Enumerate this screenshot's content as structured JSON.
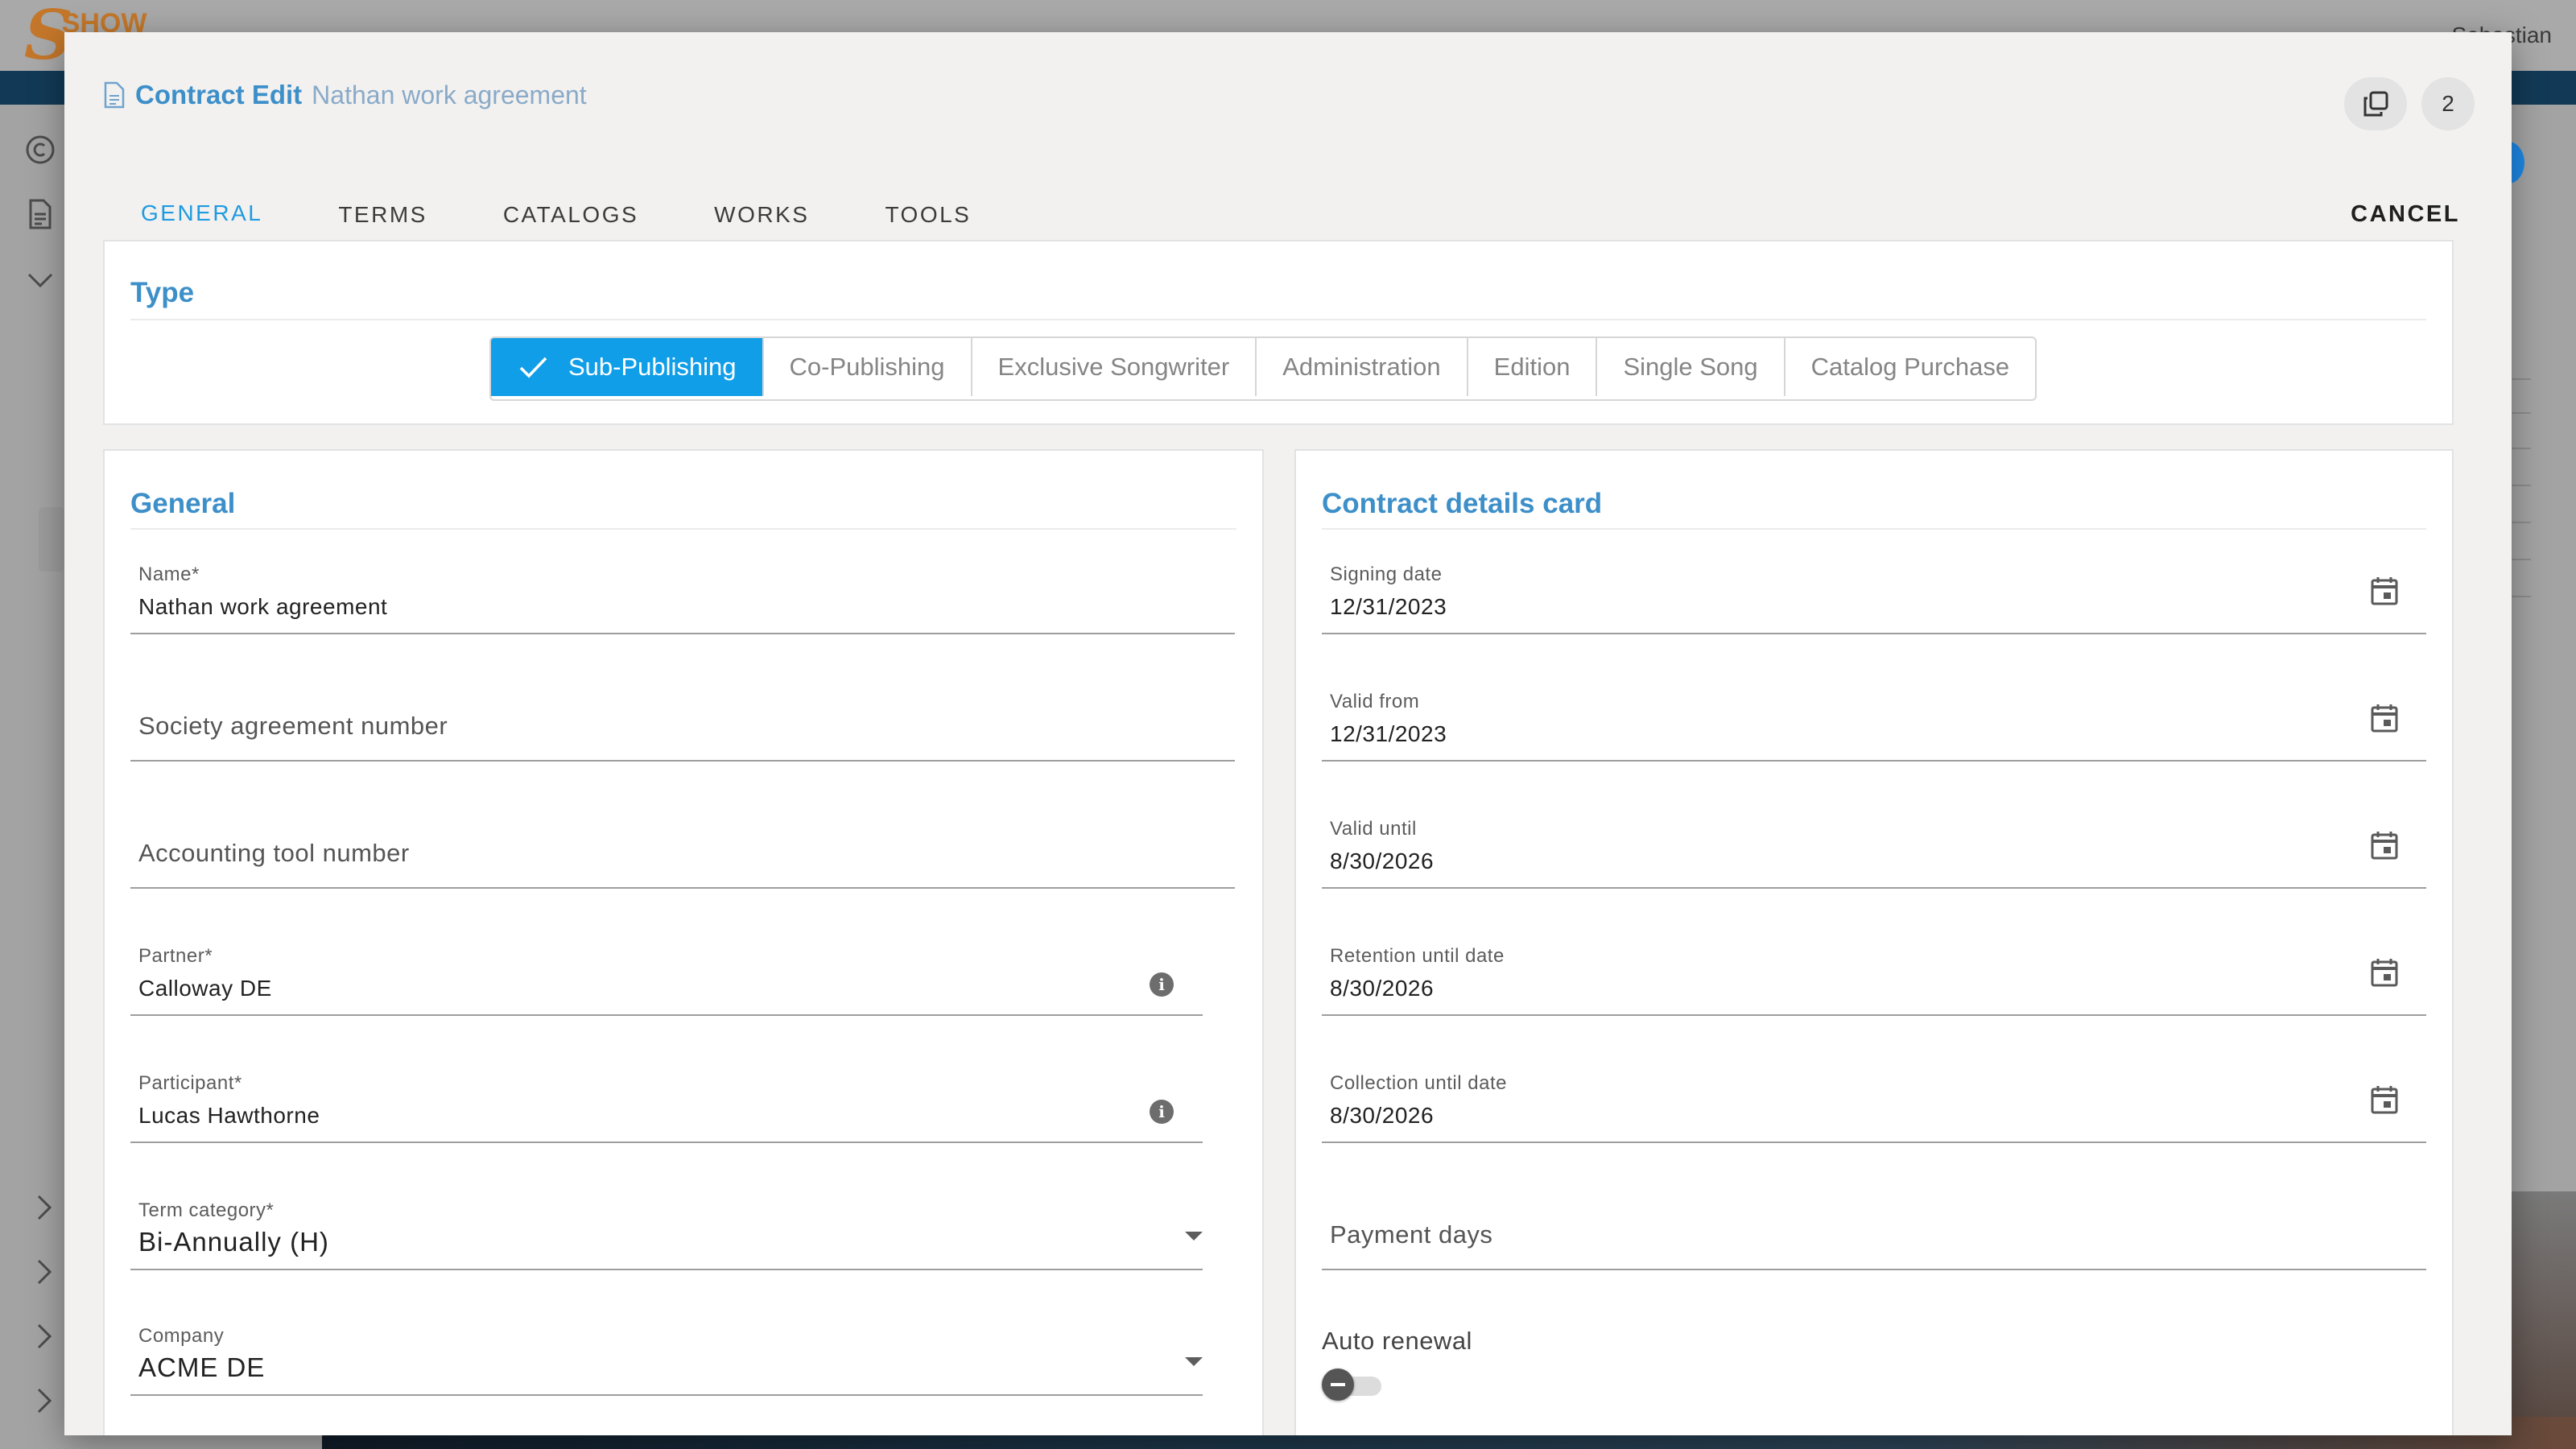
{
  "app": {
    "logo_text": "SHOW",
    "user_name": "Sebastian"
  },
  "dialog": {
    "title": "Contract Edit",
    "subtitle": "Nathan work agreement",
    "badge_count": "2",
    "copy_icon": "copy-icon",
    "cancel_label": "CANCEL",
    "tabs": [
      {
        "label": "GENERAL",
        "active": true
      },
      {
        "label": "TERMS",
        "active": false
      },
      {
        "label": "CATALOGS",
        "active": false
      },
      {
        "label": "WORKS",
        "active": false
      },
      {
        "label": "TOOLS",
        "active": false
      }
    ]
  },
  "type_card": {
    "title": "Type",
    "options": [
      {
        "label": "Sub-Publishing",
        "selected": true
      },
      {
        "label": "Co-Publishing",
        "selected": false
      },
      {
        "label": "Exclusive Songwriter",
        "selected": false
      },
      {
        "label": "Administration",
        "selected": false
      },
      {
        "label": "Edition",
        "selected": false
      },
      {
        "label": "Single Song",
        "selected": false
      },
      {
        "label": "Catalog Purchase",
        "selected": false
      }
    ]
  },
  "general_card": {
    "title": "General",
    "name": {
      "label": "Name*",
      "value": "Nathan work agreement"
    },
    "society_agreement_number": {
      "placeholder": "Society agreement number"
    },
    "accounting_tool_number": {
      "placeholder": "Accounting tool number"
    },
    "partner": {
      "label": "Partner*",
      "value": "Calloway DE"
    },
    "participant": {
      "label": "Participant*",
      "value": "Lucas Hawthorne"
    },
    "term_category": {
      "label": "Term category*",
      "value": "Bi-Annually (H)"
    },
    "company": {
      "label": "Company",
      "value": "ACME DE"
    }
  },
  "details_card": {
    "title": "Contract details card",
    "signing_date": {
      "label": "Signing date",
      "value": "12/31/2023"
    },
    "valid_from": {
      "label": "Valid from",
      "value": "12/31/2023"
    },
    "valid_until": {
      "label": "Valid until",
      "value": "8/30/2026"
    },
    "retention_until_date": {
      "label": "Retention until date",
      "value": "8/30/2026"
    },
    "collection_until_date": {
      "label": "Collection until date",
      "value": "8/30/2026"
    },
    "payment_days": {
      "placeholder": "Payment days"
    },
    "auto_renewal": {
      "label": "Auto renewal",
      "checked": false
    }
  },
  "colors": {
    "accent": "#1e9be0",
    "section_title": "#3d8fc9",
    "selected_segment": "#119ee8"
  }
}
